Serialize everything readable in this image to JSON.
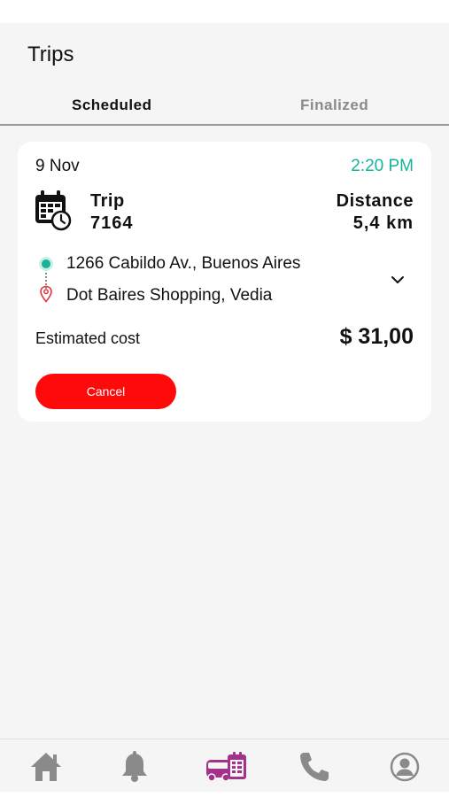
{
  "header": {
    "title": "Trips"
  },
  "tabs": [
    {
      "label": "Scheduled",
      "active": true
    },
    {
      "label": "Finalized",
      "active": false
    }
  ],
  "trip_card": {
    "date": "9 Nov",
    "time": "2:20 PM",
    "trip_label": "Trip",
    "trip_number": "7164",
    "distance_label": "Distance",
    "distance_value": "5,4 km",
    "origin": "1266 Cabildo Av., Buenos Aires",
    "destination": "Dot Baires Shopping, Vedia",
    "cost_label": "Estimated cost",
    "cost_value": "$ 31,00",
    "cancel_label": "Cancel"
  },
  "bottom_nav": {
    "items": [
      {
        "icon": "home-icon",
        "active": false
      },
      {
        "icon": "bell-icon",
        "active": false
      },
      {
        "icon": "trips-icon",
        "active": true
      },
      {
        "icon": "phone-icon",
        "active": false
      },
      {
        "icon": "profile-icon",
        "active": false
      }
    ]
  },
  "colors": {
    "accent_green": "#16b39a",
    "cancel_red": "#ff0a0a",
    "nav_active": "#a2328a",
    "nav_inactive": "#8a8a8a"
  }
}
